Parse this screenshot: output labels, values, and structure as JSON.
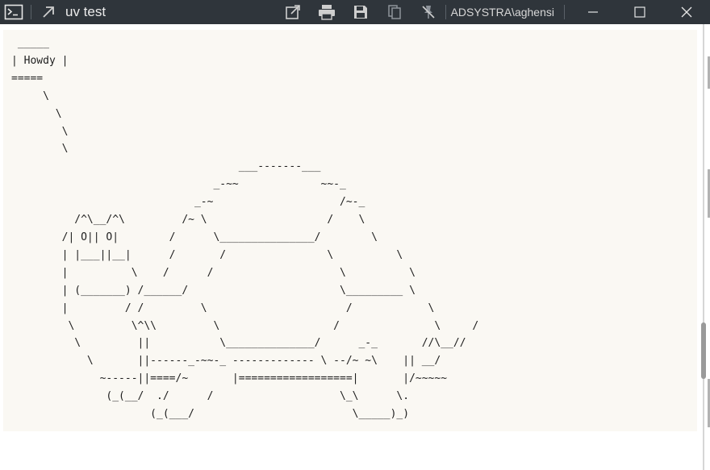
{
  "window": {
    "title": "uv test",
    "user": "ADSYSTRA\\aghensi",
    "toolbar": [
      {
        "name": "terminal-icon"
      },
      {
        "name": "expand-arrow-icon"
      },
      {
        "name": "open-external-icon"
      },
      {
        "name": "print-icon"
      },
      {
        "name": "save-icon"
      },
      {
        "name": "copy-icon"
      },
      {
        "name": "pin-off-icon"
      }
    ],
    "controls": [
      "minimize",
      "maximize",
      "close"
    ]
  },
  "terminal": {
    "output": " _____\n| Howdy |\n=====\n     \\\n       \\\n        \\\n        \\\n                                    ___-------___\n                                _-~~             ~~-_\n                             _-~                    /~-_\n          /^\\__/^\\         /~ \\                   /    \\\n        /| O|| O|        /      \\_______________/        \\\n        | |___||__|      /       /                \\          \\\n        |          \\    /      /                    \\          \\\n        | (_______) /______/                        \\_________ \\\n        |         / /         \\                      /            \\\n         \\         \\^\\\\         \\                  /               \\     /\n          \\         ||           \\______________/      _-_       //\\__//\n            \\       ||------_-~~-_ ------------- \\ --/~ ~\\    || __/\n              ~-----||====/~       |==================|       |/~~~~~\n               (_(__/  ./      /                    \\_\\      \\.\n                      (_(___/                         \\_____)_)"
  },
  "colors": {
    "titlebar_bg": "#2f353b",
    "content_bg": "#faf8f3",
    "text": "#1e1e1e"
  }
}
